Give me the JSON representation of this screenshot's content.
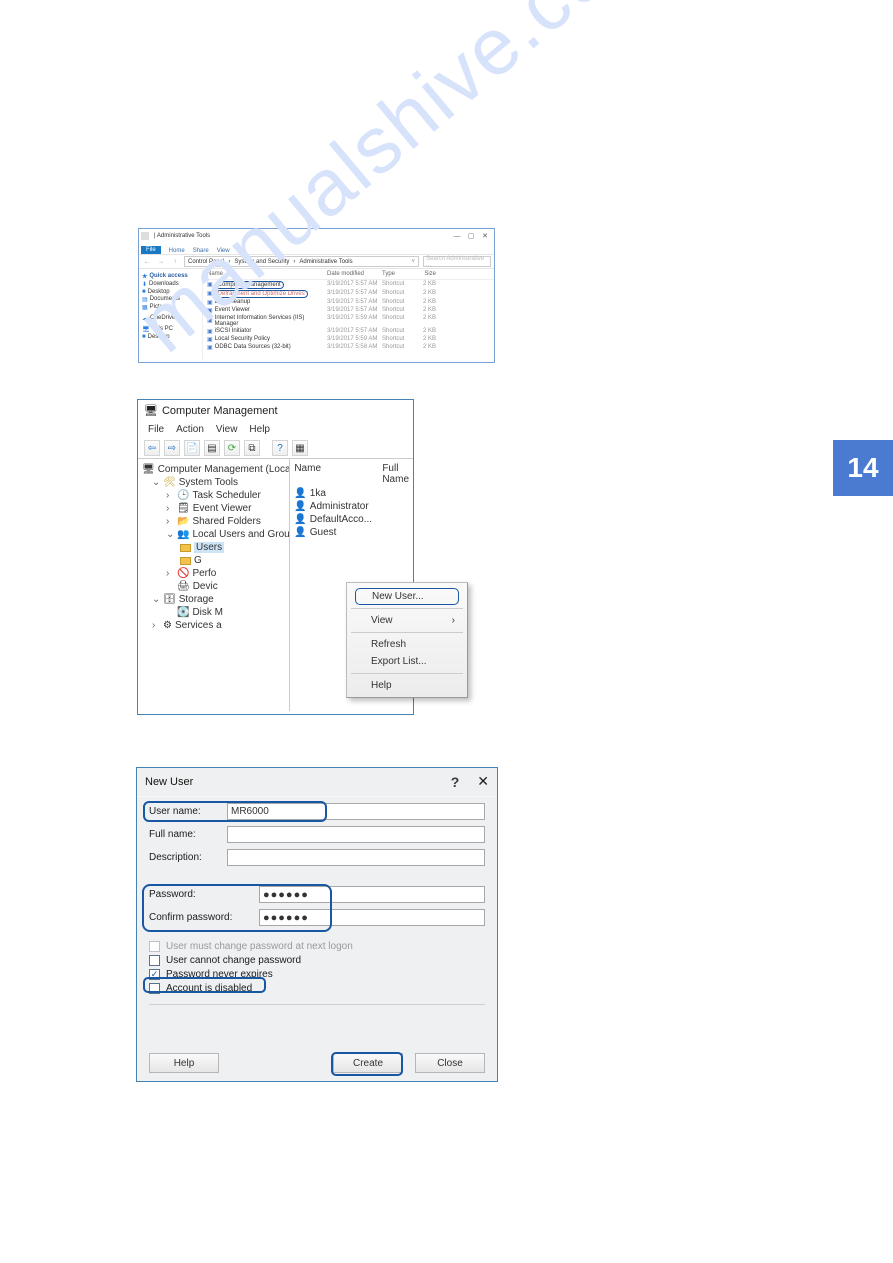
{
  "watermark": "manualshive.com",
  "page_tab": "14",
  "explorer": {
    "title": "Administrative Tools",
    "ribbon": {
      "file": "File",
      "home": "Home",
      "share": "Share",
      "view": "View"
    },
    "path_segments": [
      "Control Panel",
      "System and Security",
      "Administrative Tools"
    ],
    "search_placeholder": "Search Administrative ...",
    "sidebar": [
      {
        "label": "Quick access"
      },
      {
        "label": "Downloads"
      },
      {
        "label": "Desktop"
      },
      {
        "label": "Documents"
      },
      {
        "label": "Pictures"
      },
      {
        "label": "OneDrive"
      },
      {
        "label": "This PC"
      },
      {
        "label": "Desktop"
      }
    ],
    "columns": {
      "c1": "Name",
      "c2": "Date modified",
      "c3": "Type",
      "c4": "Size"
    },
    "rows": [
      {
        "name": "Computer Management",
        "date": "3/19/2017 5:57 AM",
        "type": "Shortcut",
        "size": "2 KB",
        "highlight": true
      },
      {
        "name": "Defragment and Optimize Drives",
        "date": "3/19/2017 5:57 AM",
        "type": "Shortcut",
        "size": "2 KB",
        "strike": true
      },
      {
        "name": "Disk Cleanup",
        "date": "3/19/2017 5:57 AM",
        "type": "Shortcut",
        "size": "2 KB"
      },
      {
        "name": "Event Viewer",
        "date": "3/19/2017 5:57 AM",
        "type": "Shortcut",
        "size": "2 KB"
      },
      {
        "name": "Internet Information Services (IIS) Manager",
        "date": "3/19/2017 5:59 AM",
        "type": "Shortcut",
        "size": "2 KB"
      },
      {
        "name": "iSCSI Initiator",
        "date": "3/19/2017 5:57 AM",
        "type": "Shortcut",
        "size": "2 KB"
      },
      {
        "name": "Local Security Policy",
        "date": "3/19/2017 5:59 AM",
        "type": "Shortcut",
        "size": "2 KB"
      },
      {
        "name": "ODBC Data Sources (32-bit)",
        "date": "3/19/2017 5:58 AM",
        "type": "Shortcut",
        "size": "2 KB"
      }
    ]
  },
  "mmc": {
    "title": "Computer Management",
    "menu": {
      "file": "File",
      "action": "Action",
      "view": "View",
      "help": "Help"
    },
    "tree": {
      "root": "Computer Management (Local",
      "system_tools": "System Tools",
      "task_scheduler": "Task Scheduler",
      "event_viewer": "Event Viewer",
      "shared_folders": "Shared Folders",
      "local_users_groups": "Local Users and Groups",
      "users": "Users",
      "groups": "G",
      "performance": "Perfo",
      "device_manager": "Devic",
      "storage": "Storage",
      "disk": "Disk M",
      "services": "Services a"
    },
    "list_cols": {
      "c1": "Name",
      "c2": "Full Name"
    },
    "list_rows": [
      {
        "name": "1ka"
      },
      {
        "name": "Administrator"
      },
      {
        "name": "DefaultAcco..."
      },
      {
        "name": "Guest"
      }
    ],
    "context_menu": {
      "new_user": "New User...",
      "view": "View",
      "refresh": "Refresh",
      "export": "Export List...",
      "help": "Help"
    }
  },
  "dlg": {
    "title": "New User",
    "labels": {
      "user_name": "User name:",
      "full_name": "Full name:",
      "description": "Description:",
      "password": "Password:",
      "confirm_password": "Confirm password:"
    },
    "values": {
      "user_name": "MR6000",
      "password_mask": "●●●●●●",
      "confirm_mask": "●●●●●●"
    },
    "checks": {
      "must_change": "User must change password at next logon",
      "cannot_change": "User cannot change password",
      "never_expires": "Password never expires",
      "disabled": "Account is disabled"
    },
    "buttons": {
      "help": "Help",
      "create": "Create",
      "close": "Close"
    }
  }
}
